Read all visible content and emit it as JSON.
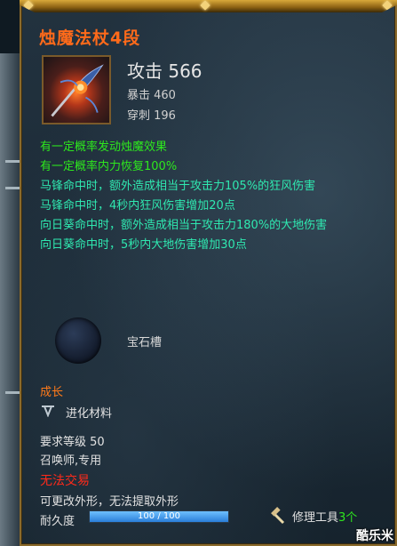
{
  "item": {
    "name": "烛魔法杖4段",
    "attack_label": "攻击 566",
    "crit_label": "暴击 460",
    "pierce_label": "穿刺 196"
  },
  "effects": [
    {
      "text": "有一定概率发动烛魔效果",
      "color": "#2ee81e"
    },
    {
      "text": "有一定概率内力恢复100%",
      "color": "#2ee81e"
    },
    {
      "text": "马锋命中时，额外造成相当于攻击力105%的狂风伤害",
      "color": "#2fe8b0"
    },
    {
      "text": "马锋命中时，4秒内狂风伤害增加20点",
      "color": "#2fe8b0"
    },
    {
      "text": "向日葵命中时，额外造成相当于攻击力180%的大地伤害",
      "color": "#2fe8b0"
    },
    {
      "text": "向日葵命中时，5秒内大地伤害增加30点",
      "color": "#2fe8b0"
    }
  ],
  "socket": {
    "label": "宝石槽"
  },
  "growth": {
    "heading": "成长",
    "material": "进化材料"
  },
  "requirements": {
    "level": "要求等级 50",
    "class": "召唤师,专用"
  },
  "trade": {
    "status": "无法交易",
    "appearance_note": "可更改外形，无法提取外形"
  },
  "durability": {
    "label": "耐久度",
    "text": "100 / 100",
    "fraction": 1.0
  },
  "repair": {
    "label": "修理工具",
    "count": "3个"
  },
  "watermark": "酷乐米",
  "colors": {
    "title": "#ff6a1a",
    "green": "#2ee81e",
    "teal": "#2fe8b0",
    "frame_gold": "#8a6a2c",
    "trade_red": "#ff2a1a"
  },
  "icons": {
    "weapon": "staff-icon",
    "socket": "gem-socket-icon",
    "growth": "growth-material-icon",
    "repair": "hammer-icon"
  }
}
